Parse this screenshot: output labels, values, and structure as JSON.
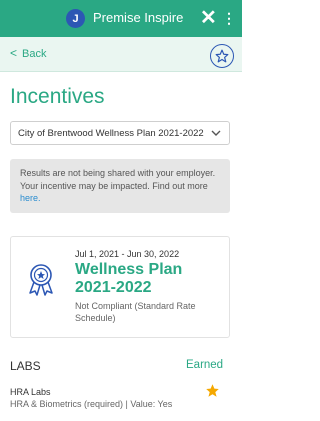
{
  "app": {
    "icon_letter": "J",
    "title": "Premise Inspire"
  },
  "nav": {
    "back_label": "Back"
  },
  "page": {
    "title": "Incentives"
  },
  "plan_select": {
    "selected": "City of Brentwood Wellness Plan 2021-2022"
  },
  "notice": {
    "text": "Results are not being shared with your employer. Your incentive may be impacted. Find out more ",
    "link": "here."
  },
  "plan_card": {
    "dates": "Jul 1, 2021 - Jun 30, 2022",
    "name": "Wellness Plan 2021-2022",
    "status": "Not Compliant (Standard Rate Schedule)"
  },
  "labs": {
    "header": "LABS",
    "status": "Earned",
    "items": [
      {
        "name": "HRA Labs",
        "detail": "HRA & Biometrics  (required) | Value: Yes"
      }
    ]
  },
  "colors": {
    "accent": "#2aa884",
    "brand_blue": "#2c57b4",
    "star": "#f5a800"
  },
  "icons": [
    "close-icon",
    "more-vertical-icon",
    "chevron-left-icon",
    "star-outline-icon",
    "chevron-down-icon",
    "award-icon",
    "star-filled-icon"
  ]
}
